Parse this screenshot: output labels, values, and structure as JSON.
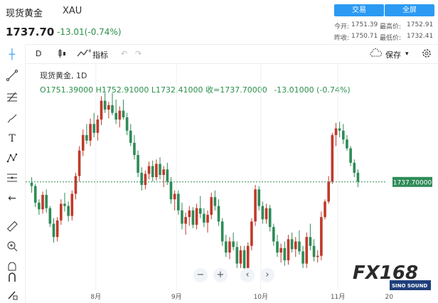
{
  "header": {
    "title": "现货黄金",
    "symbol": "XAU",
    "price": "1737.70",
    "change": "-13.01(-0.74%)",
    "trade_button": "交易",
    "fullscreen_button": "全屏",
    "today_open_label": "今开:",
    "today_open": "1751.39",
    "high_label": "最高价:",
    "high": "1752.91",
    "prev_close_label": "昨收:",
    "prev_close": "1750.71",
    "low_label": "最低价:",
    "low": "1732.41"
  },
  "toolbar": {
    "interval": "D",
    "indicators_label": "指标",
    "save_label": "保存"
  },
  "legend": {
    "line1": "现货黄金, 1D",
    "ohlc": "O1751.39000  H1752.91000  L1732.41000  收=1737.70000",
    "delta": "-13.01000 (-0.74%)"
  },
  "colors": {
    "up": "#c0392b",
    "down": "#2e8b57",
    "accent": "#2b9af3",
    "price_line": "#2e8b57"
  },
  "chart_data": {
    "type": "candlestick",
    "title": "现货黄金",
    "last_price": 1737.7,
    "price_label": "1737.70000",
    "x_tick_labels": [
      "8月",
      "9月",
      "10月",
      "11月",
      "20"
    ],
    "candles": [
      [
        1737,
        1742,
        1728,
        1734
      ],
      [
        1734,
        1736,
        1715,
        1719
      ],
      [
        1719,
        1722,
        1708,
        1713
      ],
      [
        1713,
        1729,
        1709,
        1726
      ],
      [
        1726,
        1731,
        1710,
        1714
      ],
      [
        1714,
        1716,
        1697,
        1700
      ],
      [
        1700,
        1705,
        1683,
        1688
      ],
      [
        1688,
        1706,
        1684,
        1703
      ],
      [
        1703,
        1722,
        1699,
        1718
      ],
      [
        1718,
        1728,
        1711,
        1716
      ],
      [
        1716,
        1720,
        1702,
        1707
      ],
      [
        1707,
        1730,
        1703,
        1727
      ],
      [
        1727,
        1746,
        1722,
        1743
      ],
      [
        1743,
        1770,
        1738,
        1766
      ],
      [
        1766,
        1785,
        1761,
        1780
      ],
      [
        1780,
        1790,
        1772,
        1775
      ],
      [
        1775,
        1795,
        1770,
        1790
      ],
      [
        1790,
        1800,
        1778,
        1782
      ],
      [
        1782,
        1798,
        1775,
        1794
      ],
      [
        1794,
        1815,
        1789,
        1811
      ],
      [
        1811,
        1818,
        1800,
        1803
      ],
      [
        1803,
        1810,
        1795,
        1807
      ],
      [
        1807,
        1818,
        1798,
        1800
      ],
      [
        1800,
        1812,
        1790,
        1794
      ],
      [
        1794,
        1806,
        1787,
        1802
      ],
      [
        1802,
        1812,
        1794,
        1796
      ],
      [
        1796,
        1800,
        1780,
        1784
      ],
      [
        1784,
        1790,
        1770,
        1773
      ],
      [
        1773,
        1780,
        1758,
        1762
      ],
      [
        1762,
        1766,
        1742,
        1746
      ],
      [
        1746,
        1751,
        1730,
        1735
      ],
      [
        1735,
        1748,
        1731,
        1745
      ],
      [
        1745,
        1756,
        1740,
        1752
      ],
      [
        1752,
        1757,
        1738,
        1742
      ],
      [
        1742,
        1758,
        1739,
        1754
      ],
      [
        1754,
        1760,
        1740,
        1744
      ],
      [
        1744,
        1752,
        1733,
        1749
      ],
      [
        1749,
        1755,
        1735,
        1738
      ],
      [
        1738,
        1742,
        1718,
        1722
      ],
      [
        1722,
        1730,
        1712,
        1727
      ],
      [
        1727,
        1730,
        1708,
        1712
      ],
      [
        1712,
        1719,
        1695,
        1700
      ],
      [
        1700,
        1710,
        1690,
        1706
      ],
      [
        1706,
        1716,
        1698,
        1712
      ],
      [
        1712,
        1715,
        1696,
        1699
      ],
      [
        1699,
        1718,
        1695,
        1714
      ],
      [
        1714,
        1725,
        1705,
        1709
      ],
      [
        1709,
        1714,
        1697,
        1701
      ],
      [
        1701,
        1712,
        1692,
        1708
      ],
      [
        1708,
        1728,
        1704,
        1724
      ],
      [
        1724,
        1730,
        1712,
        1716
      ],
      [
        1716,
        1722,
        1698,
        1702
      ],
      [
        1702,
        1705,
        1680,
        1684
      ],
      [
        1684,
        1690,
        1670,
        1674
      ],
      [
        1674,
        1688,
        1668,
        1684
      ],
      [
        1684,
        1692,
        1676,
        1679
      ],
      [
        1679,
        1684,
        1660,
        1664
      ],
      [
        1664,
        1680,
        1660,
        1676
      ],
      [
        1676,
        1680,
        1655,
        1660
      ],
      [
        1660,
        1683,
        1656,
        1680
      ],
      [
        1680,
        1705,
        1676,
        1702
      ],
      [
        1702,
        1735,
        1698,
        1731
      ],
      [
        1731,
        1734,
        1712,
        1716
      ],
      [
        1716,
        1720,
        1700,
        1704
      ],
      [
        1704,
        1718,
        1700,
        1714
      ],
      [
        1714,
        1717,
        1693,
        1697
      ],
      [
        1697,
        1700,
        1680,
        1684
      ],
      [
        1684,
        1690,
        1670,
        1674
      ],
      [
        1674,
        1682,
        1665,
        1678
      ],
      [
        1678,
        1684,
        1662,
        1667
      ],
      [
        1667,
        1690,
        1663,
        1686
      ],
      [
        1686,
        1692,
        1674,
        1677
      ],
      [
        1677,
        1688,
        1670,
        1684
      ],
      [
        1684,
        1694,
        1672,
        1675
      ],
      [
        1675,
        1680,
        1660,
        1664
      ],
      [
        1664,
        1692,
        1660,
        1688
      ],
      [
        1688,
        1700,
        1676,
        1680
      ],
      [
        1680,
        1686,
        1666,
        1670
      ],
      [
        1670,
        1676,
        1665,
        1671
      ],
      [
        1671,
        1711,
        1667,
        1706
      ],
      [
        1706,
        1722,
        1704,
        1720
      ],
      [
        1720,
        1743,
        1718,
        1738
      ],
      [
        1738,
        1782,
        1736,
        1780
      ],
      [
        1780,
        1791,
        1770,
        1786
      ],
      [
        1786,
        1792,
        1778,
        1784
      ],
      [
        1784,
        1790,
        1772,
        1776
      ],
      [
        1776,
        1780,
        1766,
        1768
      ],
      [
        1768,
        1770,
        1752,
        1755
      ],
      [
        1755,
        1758,
        1742,
        1746
      ],
      [
        1746,
        1749,
        1733,
        1738
      ]
    ]
  }
}
